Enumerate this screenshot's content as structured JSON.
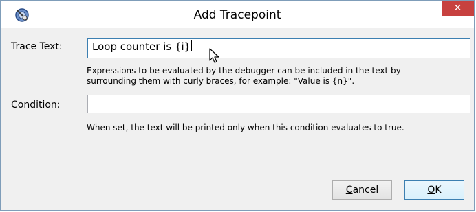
{
  "window": {
    "title": "Add Tracepoint",
    "close_label": "✕"
  },
  "form": {
    "trace_label": "Trace Text:",
    "trace_value": "Loop counter is {i}",
    "trace_hint_line1": "Expressions to be evaluated by the debugger can be included in the text by",
    "trace_hint_line2": "surrounding them with curly braces, for example: \"Value is {n}\".",
    "condition_label": "Condition:",
    "condition_value": "",
    "condition_hint": "When set, the text will be printed only when this condition evaluates to true."
  },
  "buttons": {
    "cancel_label": "Cancel",
    "cancel_mnemonic": "C",
    "cancel_rest": "ancel",
    "ok_label": "OK",
    "ok_mnemonic": "O",
    "ok_rest": "K"
  },
  "icons": {
    "app": "debugger-app-icon",
    "close": "close-icon",
    "cursor": "mouse-pointer-icon"
  },
  "colors": {
    "close_button": "#c7413f",
    "focus_border": "#3c7fb1",
    "dialog_bg": "#f0f0f0"
  }
}
